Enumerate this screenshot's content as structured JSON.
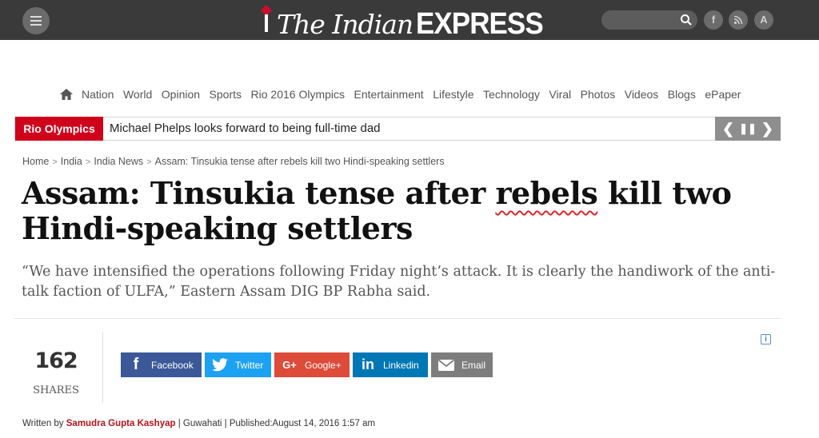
{
  "header": {
    "logo_the": "The Indian",
    "logo_express": "EXPRESS",
    "search_placeholder": "",
    "social": [
      {
        "name": "facebook",
        "glyph": "f"
      },
      {
        "name": "rss",
        "glyph": "≡"
      },
      {
        "name": "app",
        "glyph": "A"
      }
    ]
  },
  "nav": {
    "items": [
      "Nation",
      "World",
      "Opinion",
      "Sports",
      "Rio 2016 Olympics",
      "Entertainment",
      "Lifestyle",
      "Technology",
      "Viral",
      "Photos",
      "Videos",
      "Blogs",
      "ePaper"
    ]
  },
  "ticker": {
    "label": "Rio Olympics",
    "text": "Michael Phelps looks forward to being full-time dad",
    "prev": "❮",
    "pause": "❚❚",
    "next": "❯"
  },
  "breadcrumb": [
    "Home",
    "India",
    "India News",
    "Assam: Tinsukia tense after rebels kill two Hindi-speaking settlers"
  ],
  "article": {
    "headline_before": "Assam: Tinsukia tense after ",
    "headline_flagged": "rebels",
    "headline_after": " kill two Hindi-speaking settlers",
    "subhead": "“We have intensified the operations following Friday night’s attack. It is clearly the handiwork of the anti-talk faction of ULFA,” Eastern Assam DIG BP Rabha said."
  },
  "shares": {
    "count": "162",
    "label": "SHARES"
  },
  "share_buttons": [
    {
      "name": "facebook",
      "label": "Facebook",
      "glyph": "f",
      "color": "#3b5998"
    },
    {
      "name": "twitter",
      "label": "Twitter",
      "glyph": "✉",
      "color": "#1da1f2"
    },
    {
      "name": "googleplus",
      "label": "Google+",
      "glyph": "G+",
      "color": "#dd4b39"
    },
    {
      "name": "linkedin",
      "label": "Linkedin",
      "glyph": "in",
      "color": "#0077b5"
    },
    {
      "name": "email",
      "label": "Email",
      "glyph": "✉",
      "color": "#7d7d7d"
    }
  ],
  "byline": {
    "prefix": "Written by ",
    "author": "Samudra Gupta Kashyap",
    "rest": " | Guwahati | Published:August 14, 2016 1:57 am"
  },
  "ad_info": "i"
}
